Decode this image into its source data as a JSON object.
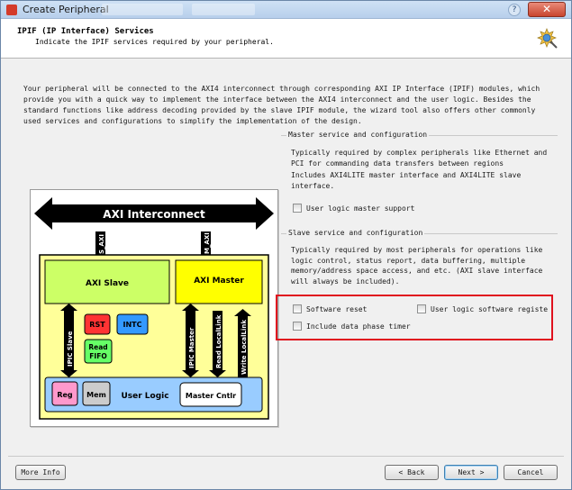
{
  "window": {
    "title": "Create Peripheral",
    "close_label": "✕",
    "help_label": "?"
  },
  "header": {
    "title": "IPIF (IP Interface) Services",
    "subtitle": "Indicate the IPIF services required by your peripheral."
  },
  "description": "Your peripheral will be connected to the AXI4 interconnect through corresponding AXI IP Interface (IPIF) modules, which provide you with a quick way to implement the interface between the AXI4 interconnect and the user logic. Besides the standard functions like address decoding provided by the slave IPIF module, the wizard tool also offers other commonly used services and configurations to simplify the implementation of the design.",
  "diagram": {
    "axi_interconnect": "AXI Interconnect",
    "s_axi": "S_AXI",
    "m_axi": "M_AXI",
    "axi_slave": "AXI Slave",
    "axi_master": "AXI Master",
    "ipic_slave": "IPIC Slave",
    "ipic_master": "IPIC Master",
    "read_locallink": "Read LocalLink",
    "write_locallink": "Write LocalLink",
    "rst": "RST",
    "intc": "INTC",
    "read_fifo_1": "Read",
    "read_fifo_2": "FIFO",
    "reg": "Reg",
    "mem": "Mem",
    "user_logic": "User Logic",
    "master_cntlr": "Master Cntlr"
  },
  "master_group": {
    "legend": "Master service and configuration",
    "text1": "Typically required by complex peripherals like Ethernet and PCI for commanding data transfers between regions",
    "text2": "Includes AXI4LITE master interface and AXI4LITE slave interface.",
    "options": [
      {
        "label": "User logic master support",
        "checked": false
      }
    ]
  },
  "slave_group": {
    "legend": "Slave service and configuration",
    "text": "Typically required by most peripherals for operations like logic control, status report, data buffering, multiple memory/address space access, and etc. (AXI slave interface will always be included).",
    "options": [
      {
        "label": "Software reset",
        "checked": false
      },
      {
        "label": "User logic software registe",
        "checked": false
      },
      {
        "label": "Include data phase timer",
        "checked": false
      }
    ]
  },
  "footer": {
    "more_info": "More Info",
    "back": "< Back",
    "next": "Next >",
    "cancel": "Cancel"
  },
  "colors": {
    "interconnect": "#000000",
    "outer_block": "#ffff99",
    "axi_slave": "#ccff66",
    "axi_master": "#ffff00",
    "user_logic": "#99ccff",
    "rst": "#ff3333",
    "intc": "#3399ff",
    "read_fifo": "#66ff66",
    "reg": "#ff99cc",
    "mem": "#cccccc",
    "highlight": "#e0121e"
  }
}
